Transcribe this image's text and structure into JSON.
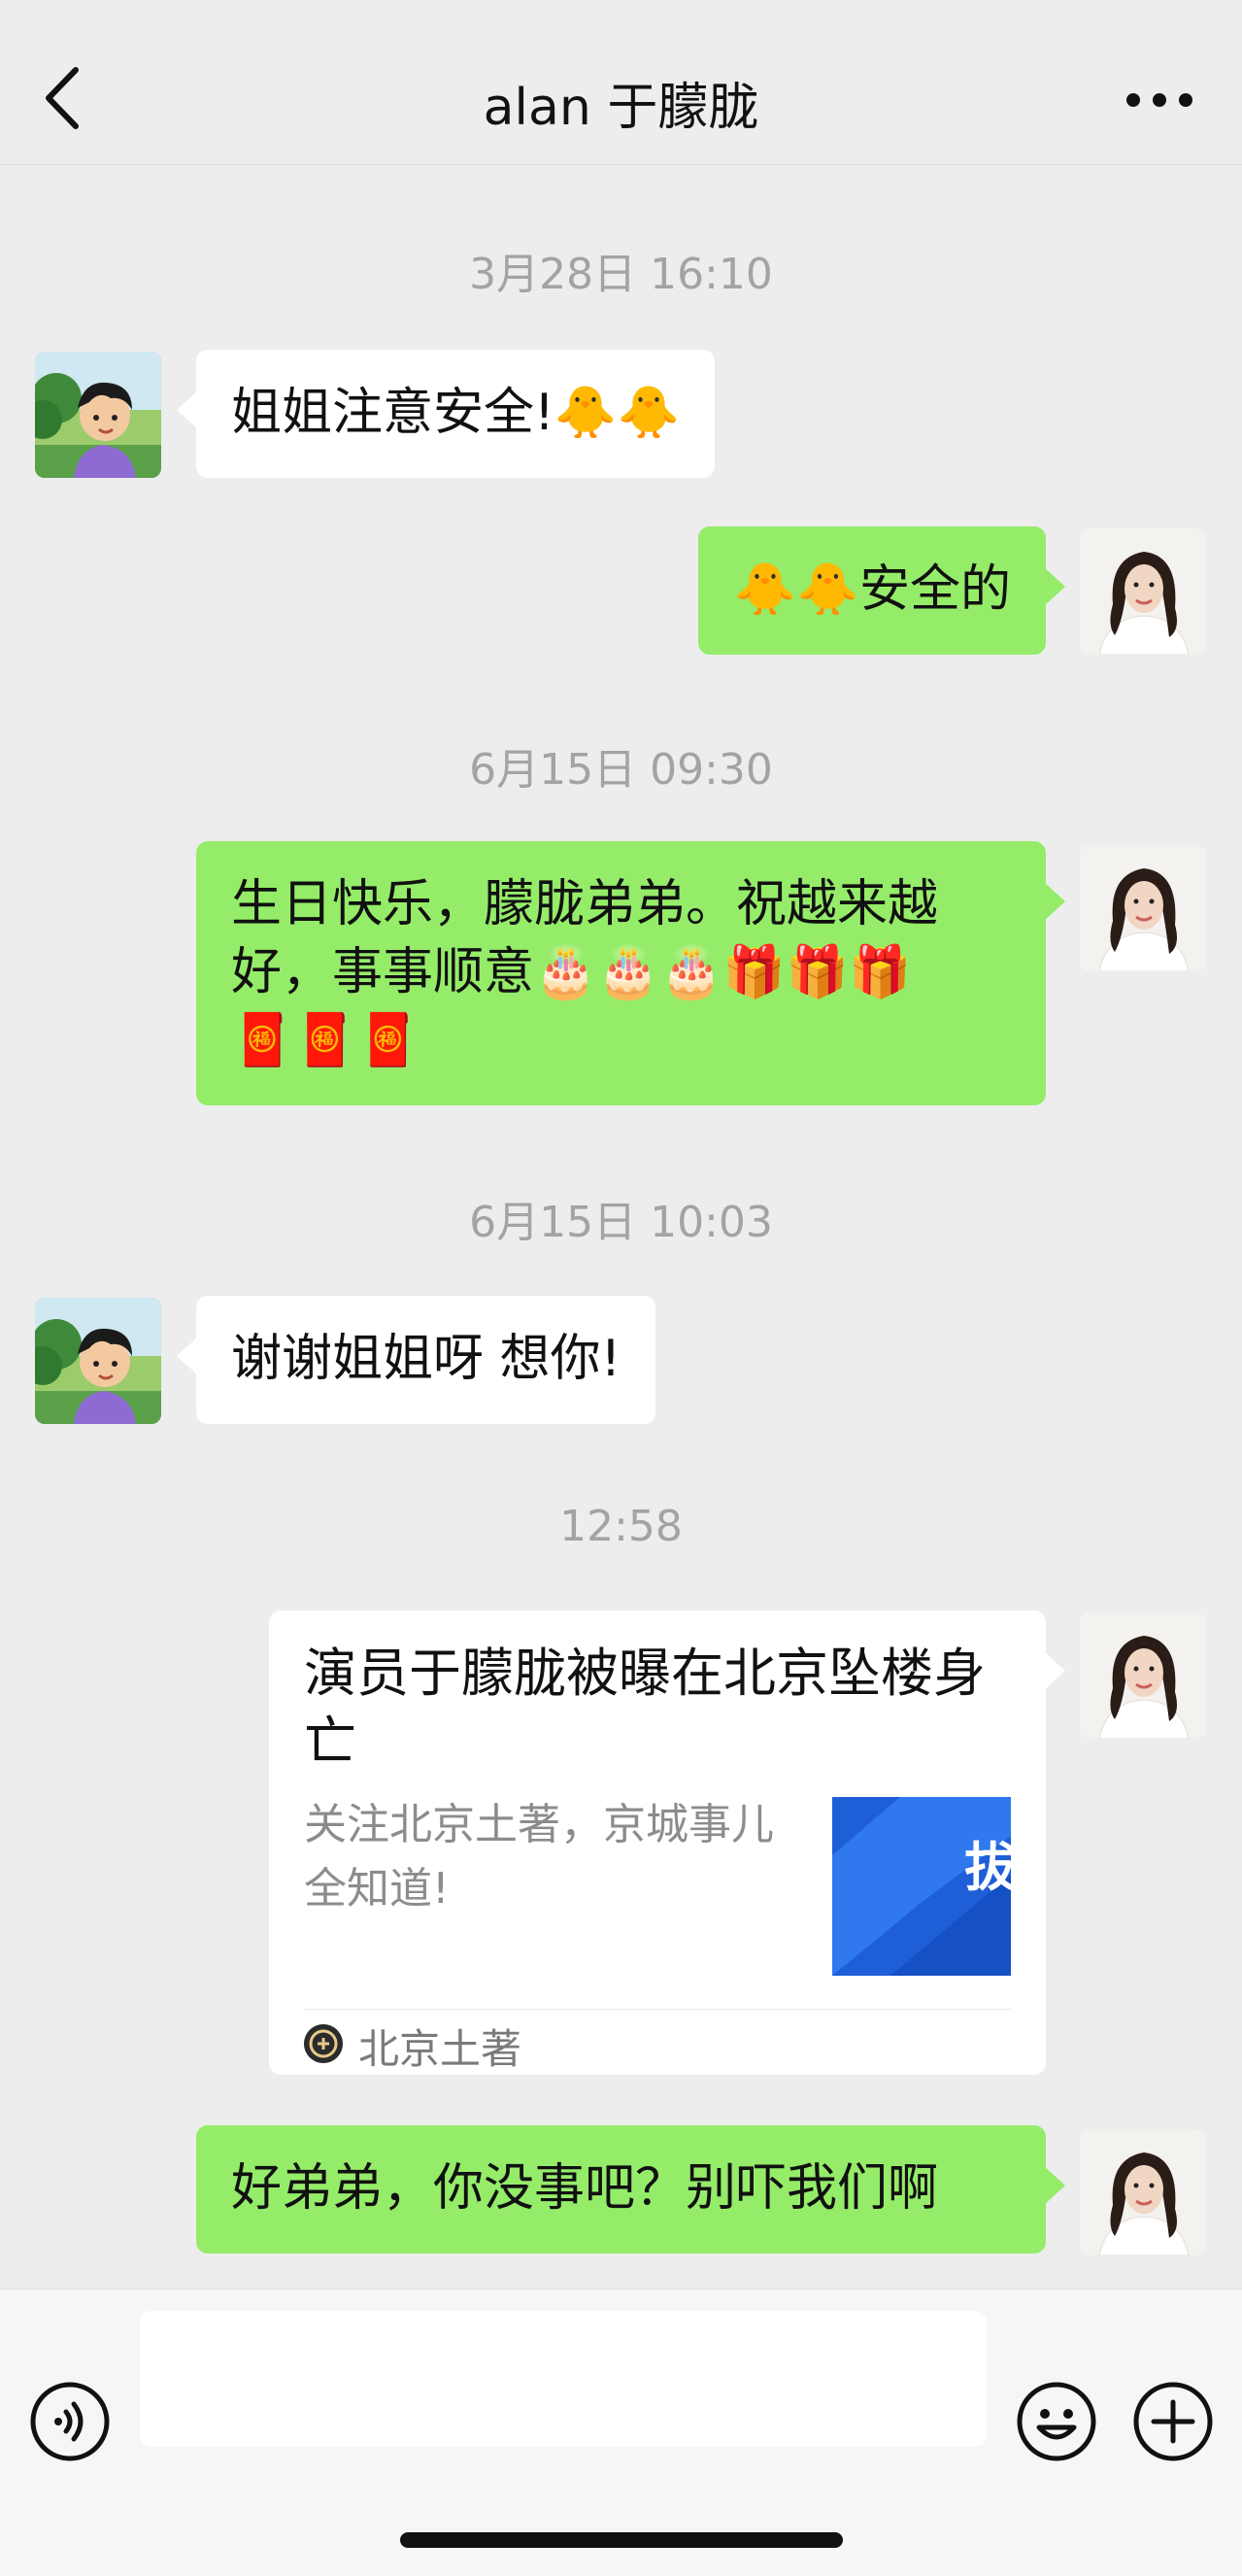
{
  "nav": {
    "title": "alan 于朦胧",
    "back_icon": "chevron-left-icon",
    "more_icon": "ellipsis-icon"
  },
  "colors": {
    "background": "#EDEDED",
    "sent_bubble": "#95EC69",
    "received_bubble": "#FFFFFF",
    "timestamp": "#A3A3A3"
  },
  "messages": {
    "ts1": "3月28日 16:10",
    "m1_text": "姐姐注意安全!",
    "m1_emoji": "🐥🐥",
    "m2_emoji": "🐥🐥",
    "m2_text": "安全的",
    "ts2": "6月15日 09:30",
    "m3_line1": "生日快乐，朦胧弟弟。祝越来越",
    "m3_line2_text": "好，事事顺意",
    "m3_line2_emoji": "🎂🎂🎂🎁🎁🎁",
    "m3_line3_emoji": "🧧🧧🧧",
    "ts3": "6月15日 10:03",
    "m4_text": "谢谢姐姐呀 想你!",
    "ts4": "12:58",
    "m6_text": "好弟弟，你没事吧？别吓我们啊"
  },
  "article": {
    "title": "演员于朦胧被曝在北京坠楼身亡",
    "description": "关注北京土著，京城事儿全知道!",
    "thumb_text": "拔",
    "source": "北京土著"
  },
  "input_bar": {
    "placeholder": "",
    "voice_icon": "voice-icon",
    "emoji_icon": "emoji-icon",
    "plus_icon": "plus-icon"
  }
}
